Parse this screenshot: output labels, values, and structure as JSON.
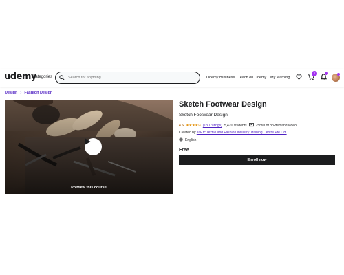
{
  "header": {
    "logo": "udemy",
    "categories": "Categories",
    "search_placeholder": "Search for anything",
    "business": "Udemy Business",
    "teach": "Teach on Udemy",
    "learning": "My learning",
    "cart_count": "1",
    "icons": [
      "search-icon",
      "heart-icon",
      "cart-icon",
      "bell-icon"
    ]
  },
  "breadcrumb": {
    "items": [
      "Design",
      "Fashion Design"
    ],
    "separator": "›"
  },
  "preview": {
    "label": "Preview this course"
  },
  "course": {
    "title": "Sketch Footwear Design",
    "subtitle": "Sketch Footwear Design",
    "rating": "4.5",
    "stars": "★★★★½",
    "ratings_count": "(130 ratings)",
    "students": "5,420 students",
    "video": "25min of on-demand video",
    "created_by_label": "Created by",
    "instructor": "TaF.tc Textile and Fashion Industry Training Centre Pte Ltd.",
    "language": "English",
    "price": "Free",
    "enroll_label": "Enroll now"
  },
  "colors": {
    "accent": "#a435f0",
    "link": "#5022c3",
    "rating": "#b4690e",
    "star": "#e59819",
    "button_bg": "#1c1d1f"
  }
}
